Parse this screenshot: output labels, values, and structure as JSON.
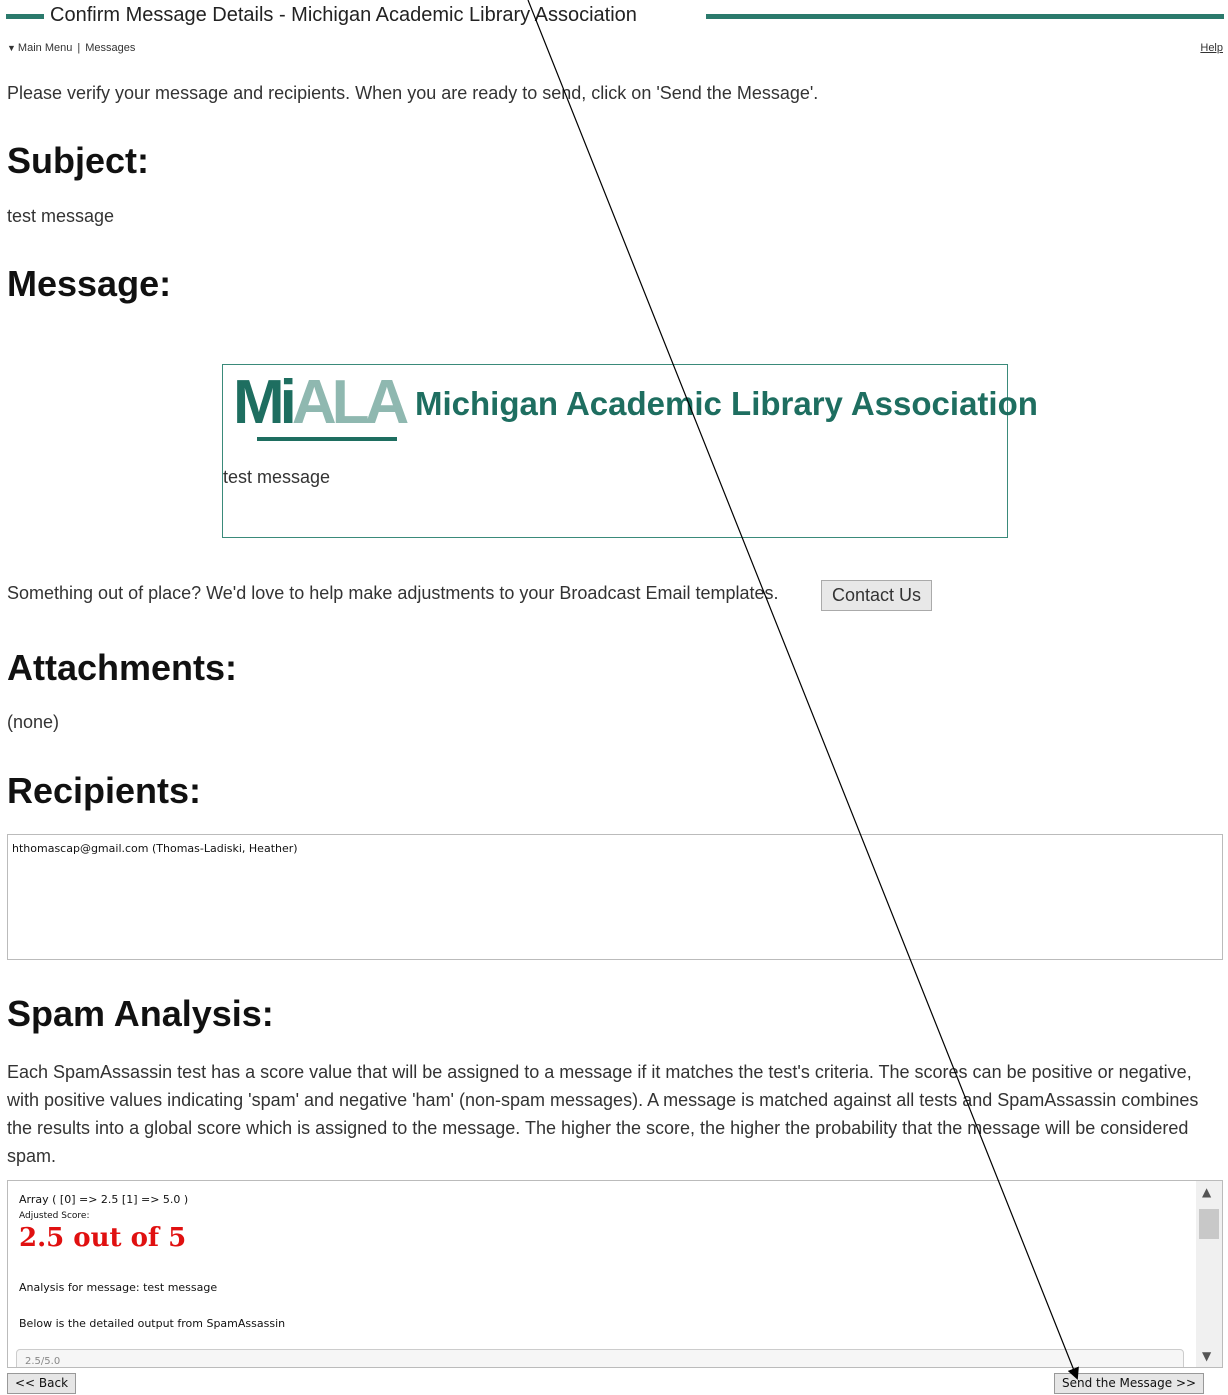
{
  "header": {
    "title": "Confirm Message Details - Michigan Academic Library Association",
    "accent_color": "#2b7a6c"
  },
  "nav": {
    "main_menu": "Main Menu",
    "separator": "|",
    "messages": "Messages",
    "help": "Help"
  },
  "intro": "Please verify your message and recipients. When you are ready to send, click on 'Send the Message'.",
  "subject": {
    "heading": "Subject:",
    "value": "test message"
  },
  "message": {
    "heading": "Message:",
    "logo_mark_a": "Mi",
    "logo_mark_b": "ALA",
    "logo_text": "Michigan Academic Library Association",
    "body": "test message"
  },
  "contact": {
    "prompt": "Something out of place? We'd love to help make adjustments to your Broadcast Email templates.",
    "button_label": "Contact Us"
  },
  "attachments": {
    "heading": "Attachments:",
    "value": "(none)"
  },
  "recipients": {
    "heading": "Recipients:",
    "list": "hthomascap@gmail.com (Thomas-Ladiski, Heather)"
  },
  "spam": {
    "heading": "Spam Analysis:",
    "description": "Each SpamAssassin test has a score value that will be assigned to a message if it matches the test's criteria. The scores can be positive or negative, with positive values indicating 'spam' and negative 'ham' (non-spam messages). A message is matched against all tests and SpamAssassin combines the results into a global score which is assigned to the message. The higher the score, the higher the probability that the message will be considered spam.",
    "array_line": "Array ( [0] => 2.5 [1] => 5.0 )",
    "adjusted_label": "Adjusted Score:",
    "score": "2.5 out of 5",
    "analysis_line": "Analysis for message: test message",
    "detail_line": "Below is the detailed output from SpamAssassin",
    "pre_snippet": "2.5/5.0",
    "score_color": "#e01010"
  },
  "footer": {
    "back_label": "<< Back",
    "send_label": "Send the Message >>"
  }
}
